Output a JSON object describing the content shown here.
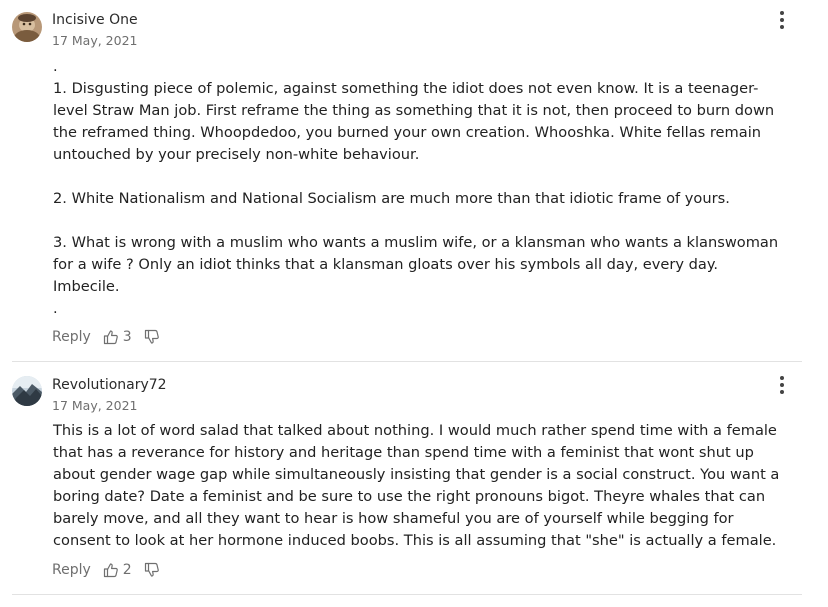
{
  "comments": [
    {
      "author": "Incisive One",
      "date": "17 May, 2021",
      "lines": [
        ".",
        "1. Disgusting piece of polemic, against something the idiot does not even know.  It is a teenager-",
        "level Straw Man job.  First reframe the thing as something that it is not, then proceed to burn down",
        "the reframed thing.  Whoopdedoo, you burned your own creation.  Whooshka.  White fellas remain",
        "untouched by your precisely non-white behaviour.",
        "",
        "2. White Nationalism and National Socialism are much more than that idiotic frame of yours.",
        "",
        "3. What is wrong with a muslim who wants a muslim wife, or a klansman who wants a klanswoman",
        "for a wife ?  Only an idiot thinks that a klansman gloats over his symbols all day, every day.",
        "Imbecile.",
        "."
      ],
      "reply_label": "Reply",
      "likes": "3"
    },
    {
      "author": "Revolutionary72",
      "date": "17 May, 2021",
      "lines": [
        "This is a lot of word salad that talked about nothing. I would much rather spend time with a female",
        "that has a reverance for history and heritage than spend time with a feminist that wont shut up",
        "about gender wage gap while simultaneously insisting that gender is a social construct. You want a",
        "boring date? Date a feminist and be sure to use the right pronouns bigot. Theyre whales that can",
        "barely move, and all they want to hear is how shameful you are of yourself while begging for",
        "consent to look at her hormone induced boobs. This is all assuming that \"she\" is actually a female."
      ],
      "reply_label": "Reply",
      "likes": "2"
    }
  ],
  "icons": {
    "more": "vertical-ellipsis-icon",
    "like": "thumbs-up-icon",
    "dislike": "thumbs-down-icon"
  }
}
